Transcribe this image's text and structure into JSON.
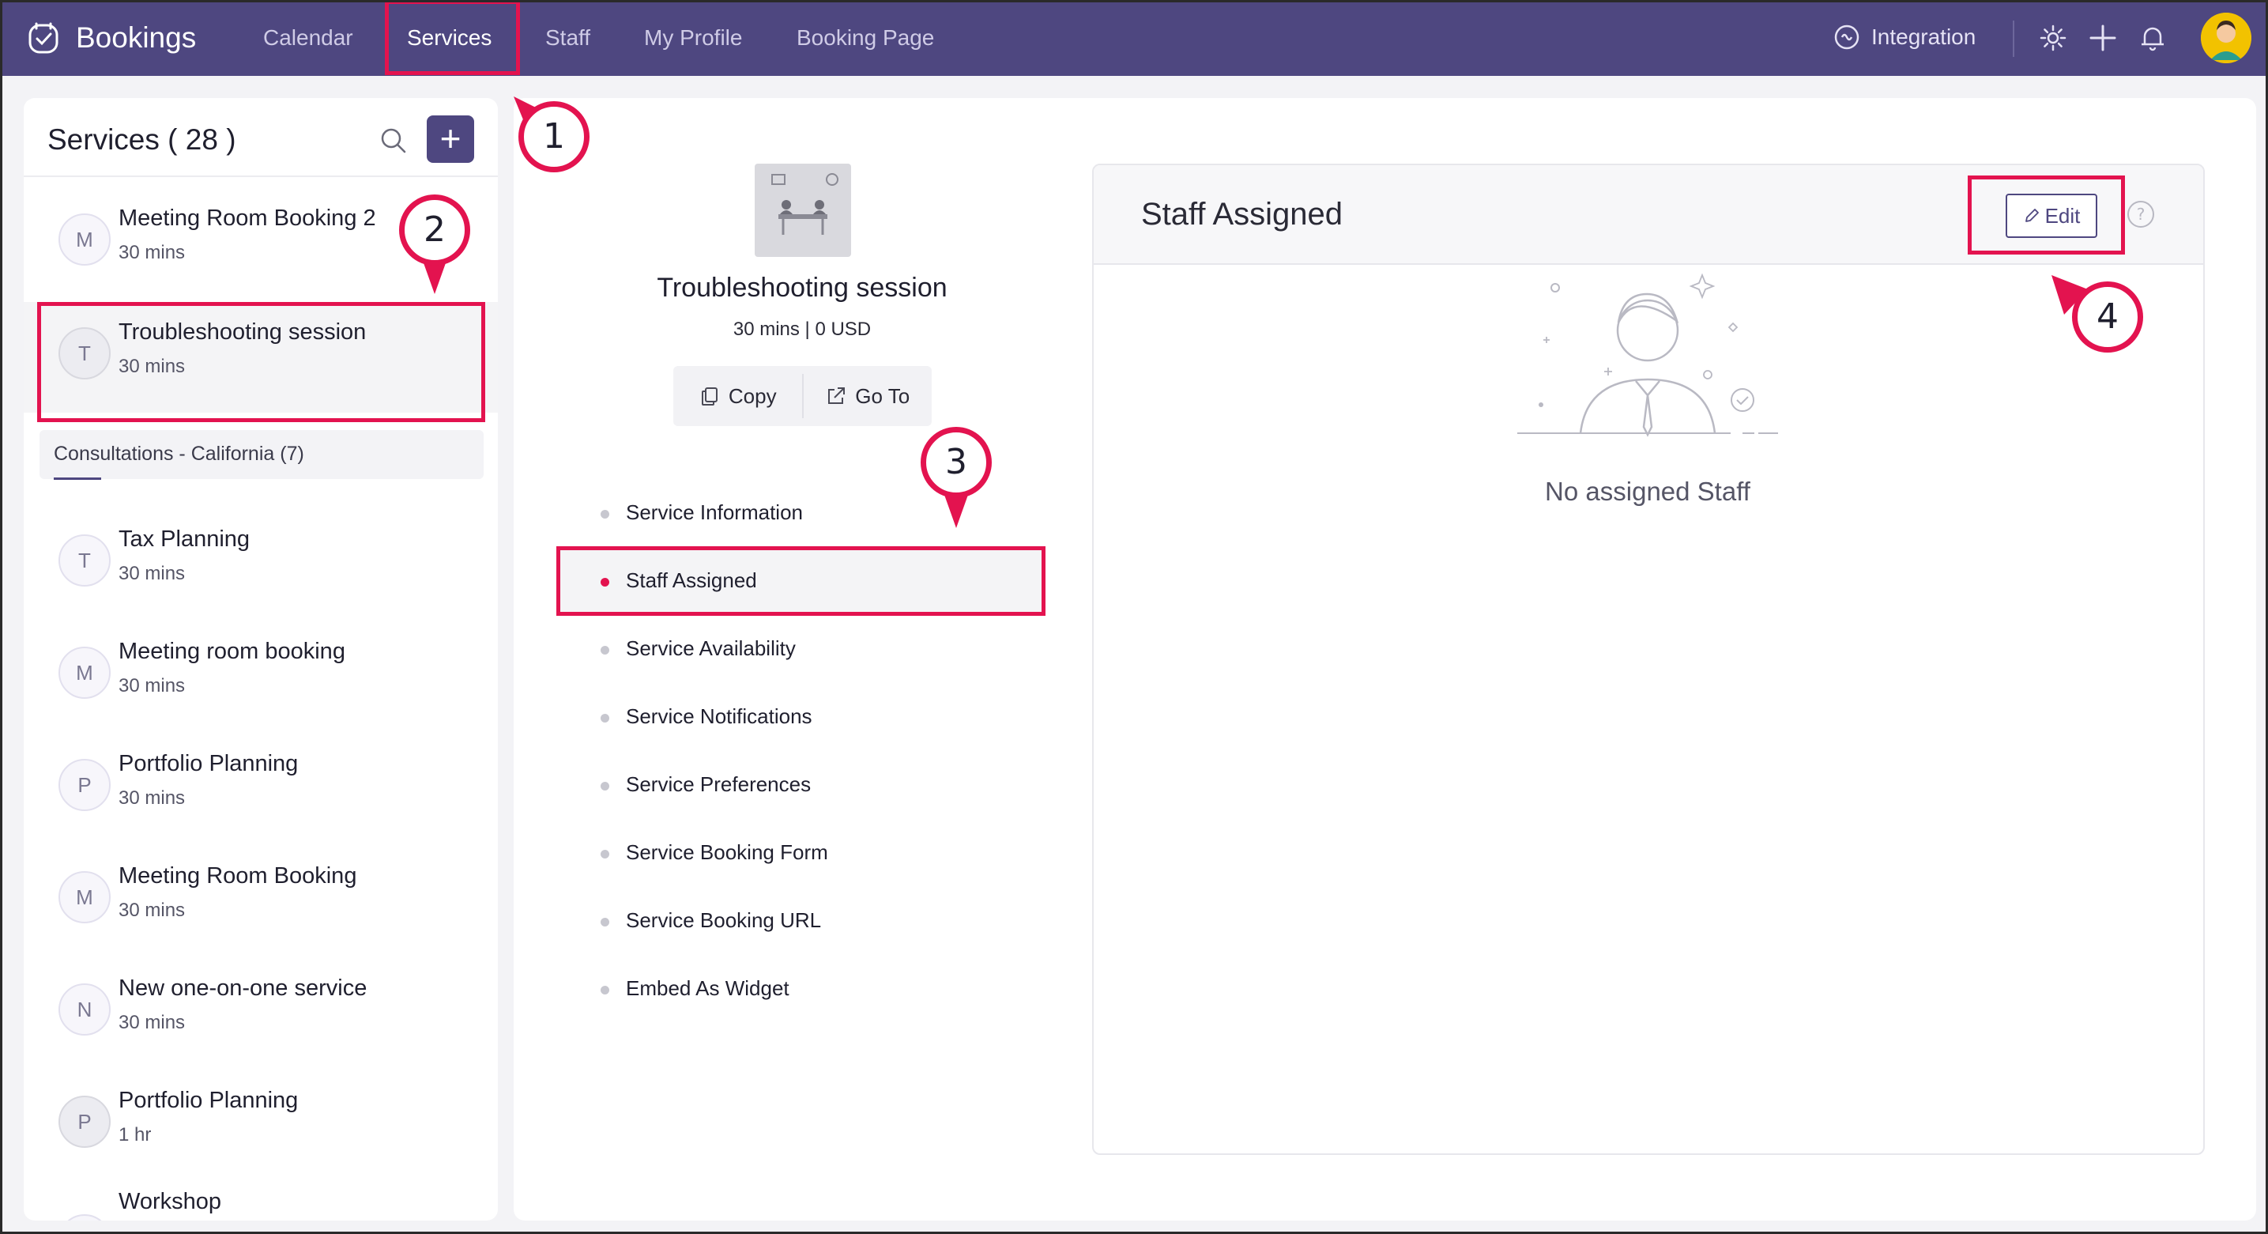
{
  "app": {
    "name": "Bookings"
  },
  "nav": {
    "items": [
      {
        "label": "Calendar"
      },
      {
        "label": "Services",
        "active": true
      },
      {
        "label": "Staff"
      },
      {
        "label": "My Profile"
      },
      {
        "label": "Booking Page"
      }
    ],
    "integration_label": "Integration",
    "icons": [
      "settings-icon",
      "plus-icon",
      "bell-icon",
      "user-avatar"
    ]
  },
  "services_panel": {
    "title": "Services ( 28 )",
    "add_label": "+",
    "group_label": "Consultations - California (7)",
    "items": [
      {
        "initial": "M",
        "name": "Meeting Room Booking 2",
        "duration": "30 mins"
      },
      {
        "initial": "T",
        "name": "Troubleshooting session",
        "duration": "30 mins",
        "selected": true
      },
      {
        "initial": "T",
        "name": "Tax Planning",
        "duration": "30 mins"
      },
      {
        "initial": "M",
        "name": "Meeting room booking",
        "duration": "30 mins"
      },
      {
        "initial": "P",
        "name": "Portfolio Planning",
        "duration": "30 mins"
      },
      {
        "initial": "M",
        "name": "Meeting Room Booking",
        "duration": "30 mins"
      },
      {
        "initial": "N",
        "name": "New one-on-one service",
        "duration": "30 mins"
      },
      {
        "initial": "P",
        "name": "Portfolio Planning",
        "duration": "1 hr"
      },
      {
        "initial": "",
        "name": "Workshop",
        "duration": ""
      }
    ]
  },
  "service_detail": {
    "title": "Troubleshooting session",
    "meta": "30 mins | 0 USD",
    "copy_label": "Copy",
    "goto_label": "Go To",
    "menu": [
      {
        "label": "Service Information"
      },
      {
        "label": "Staff Assigned",
        "active": true
      },
      {
        "label": "Service Availability"
      },
      {
        "label": "Service Notifications"
      },
      {
        "label": "Service Preferences"
      },
      {
        "label": "Service Booking Form"
      },
      {
        "label": "Service Booking URL"
      },
      {
        "label": "Embed As Widget"
      }
    ]
  },
  "staff_card": {
    "title": "Staff Assigned",
    "edit_label": "Edit",
    "help_label": "?",
    "empty_text": "No assigned Staff"
  },
  "callouts": [
    "1",
    "2",
    "3",
    "4"
  ],
  "colors": {
    "topbar": "#4e4780",
    "highlight": "#e3134f",
    "panel_bg": "#f3f3f6"
  }
}
